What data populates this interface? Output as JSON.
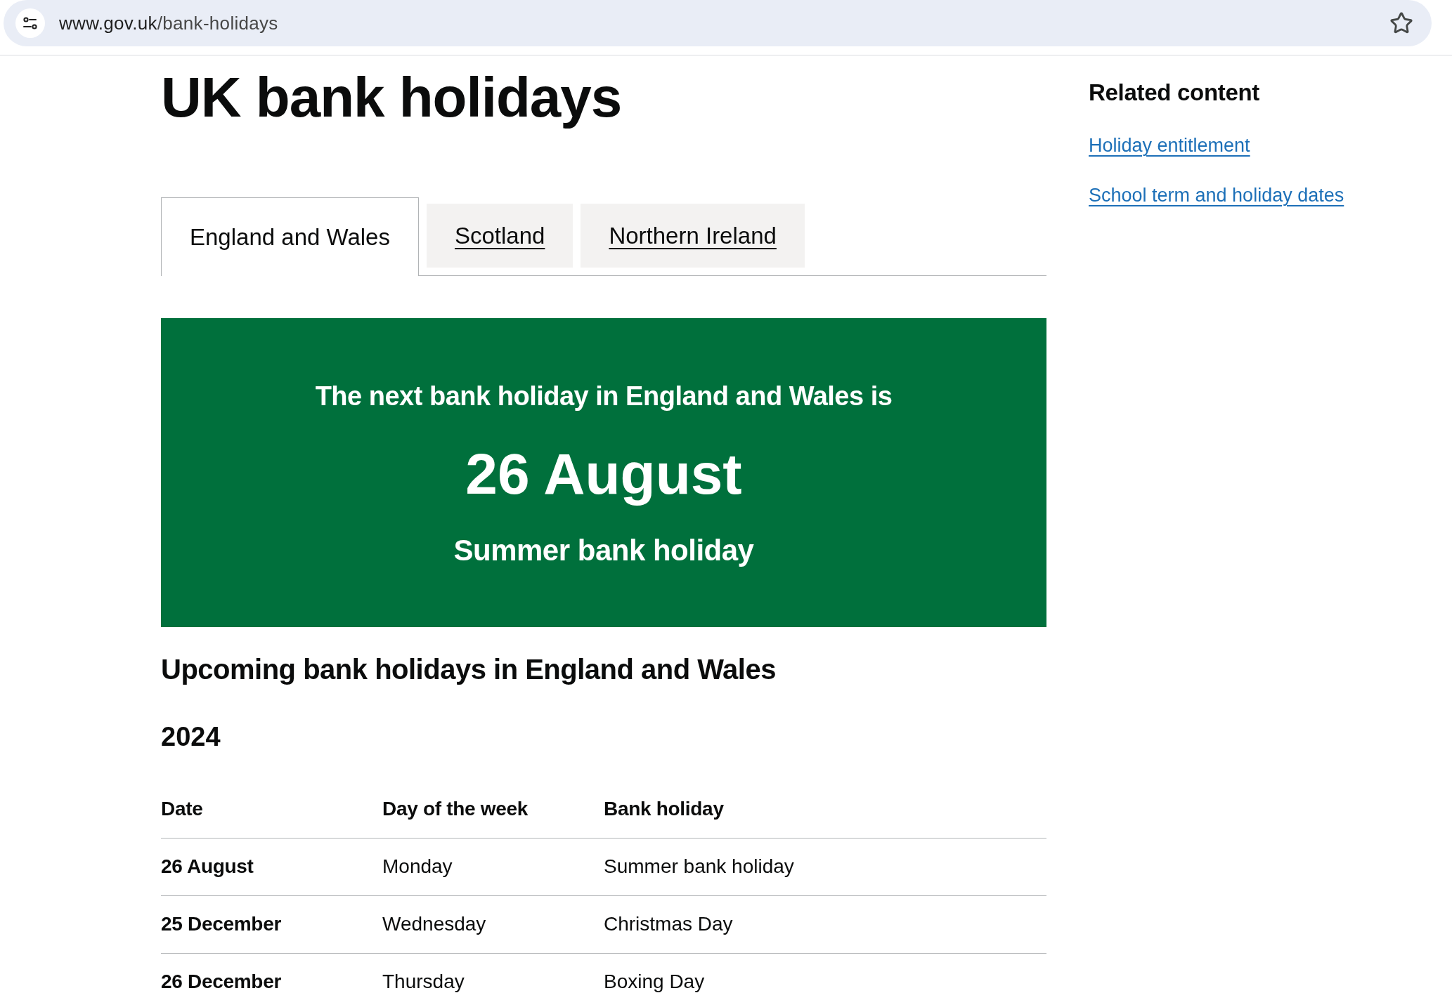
{
  "browser": {
    "url_host": "www.gov.uk",
    "url_path": "/bank-holidays"
  },
  "title": "UK bank holidays",
  "tabs": [
    {
      "label": "England and Wales",
      "selected": true
    },
    {
      "label": "Scotland",
      "selected": false
    },
    {
      "label": "Northern Ireland",
      "selected": false
    }
  ],
  "next_holiday_banner": {
    "heading": "The next bank holiday in England and Wales is",
    "date": "26 August",
    "name": "Summer bank holiday"
  },
  "upcoming": {
    "heading": "Upcoming bank holidays in England and Wales",
    "year": "2024",
    "table": {
      "columns": [
        "Date",
        "Day of the week",
        "Bank holiday"
      ],
      "rows": [
        [
          "26 August",
          "Monday",
          "Summer bank holiday"
        ],
        [
          "25 December",
          "Wednesday",
          "Christmas Day"
        ],
        [
          "26 December",
          "Thursday",
          "Boxing Day"
        ]
      ]
    }
  },
  "related_content": {
    "heading": "Related content",
    "links": [
      "Holiday entitlement",
      "School term and holiday dates"
    ]
  }
}
